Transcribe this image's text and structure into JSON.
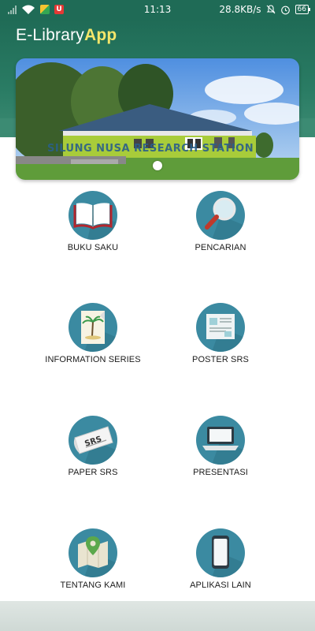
{
  "status_bar": {
    "time": "11:13",
    "network_speed": "28.8KB/s",
    "battery": "66",
    "app_badge": "U"
  },
  "header": {
    "title_prefix": "E-Library",
    "title_accent": "App",
    "colors": {
      "primary": "#1f6b56",
      "accent": "#f5e66a",
      "icon_bg": "#3b8aa1"
    }
  },
  "banner": {
    "sign_text": "SILUNG NUSA RESEARCH STATION",
    "page_indicator_count": 1
  },
  "menu": [
    {
      "label": "BUKU SAKU",
      "icon": "book-icon"
    },
    {
      "label": "PENCARIAN",
      "icon": "magnifier-icon"
    },
    {
      "label": "INFORMATION SERIES",
      "icon": "document-palm-icon"
    },
    {
      "label": "POSTER SRS",
      "icon": "poster-icon"
    },
    {
      "label": "PAPER SRS",
      "icon": "newspaper-icon"
    },
    {
      "label": "PRESENTASI",
      "icon": "laptop-icon"
    },
    {
      "label": "TENTANG KAMI",
      "icon": "map-pin-icon"
    },
    {
      "label": "APLIKASI LAIN",
      "icon": "smartphone-icon"
    }
  ]
}
